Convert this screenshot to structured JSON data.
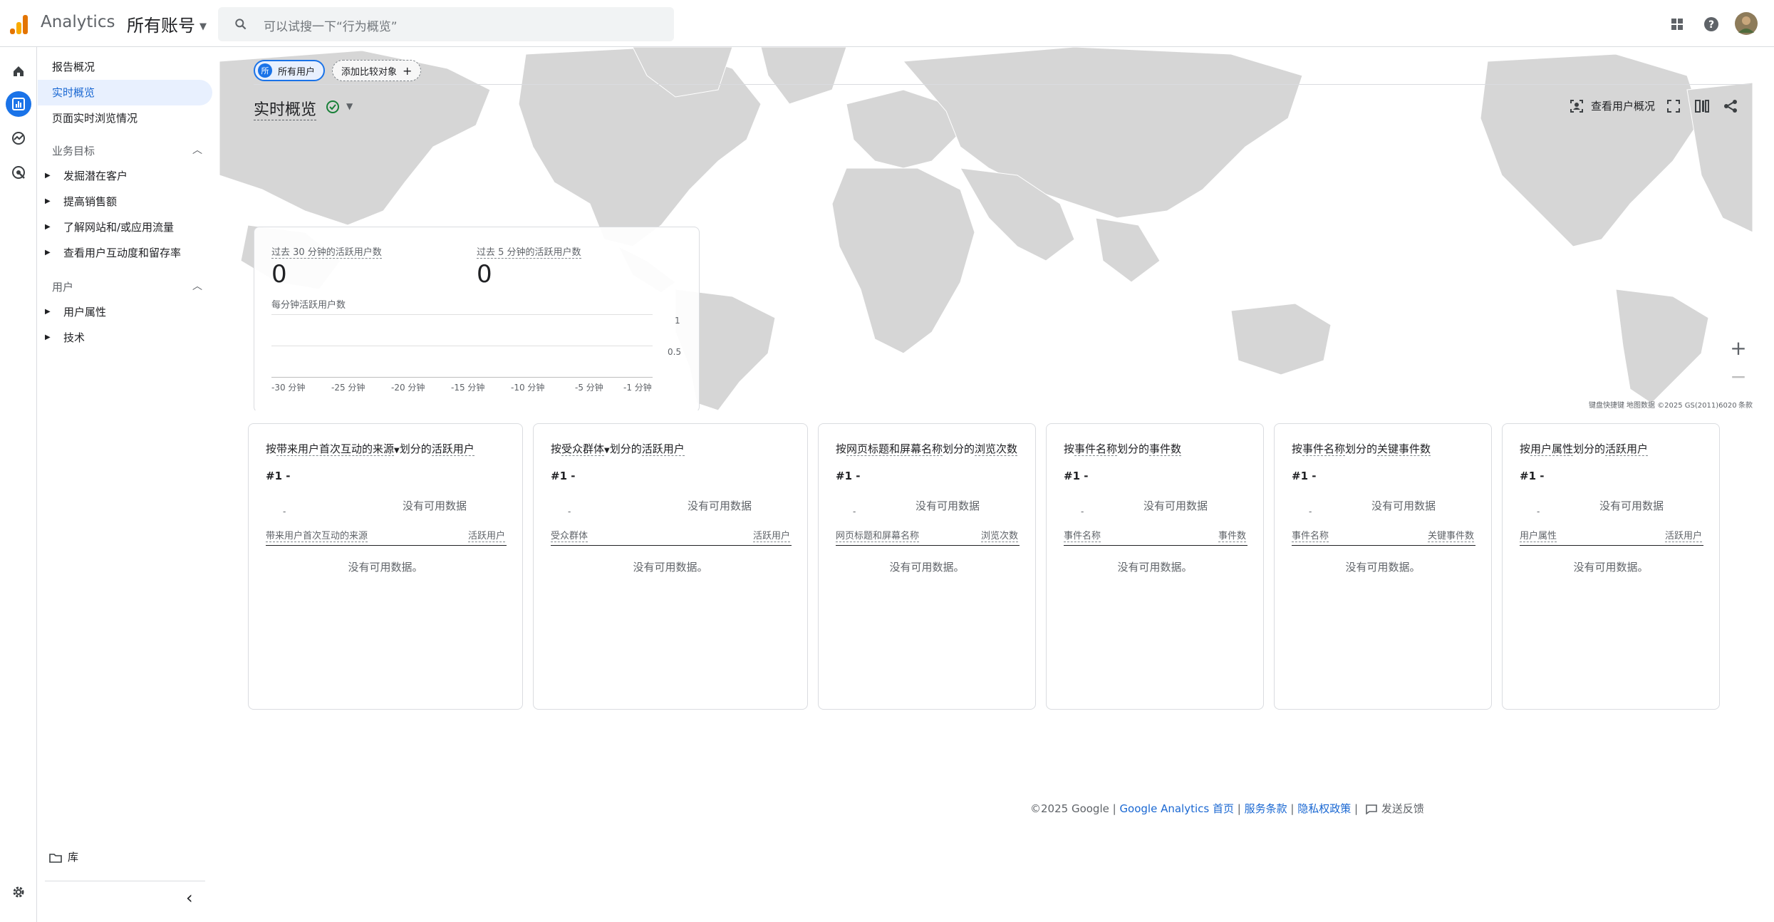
{
  "app": {
    "name": "Analytics",
    "account": "所有账号",
    "search_placeholder": "可以试搜一下“行为概览”"
  },
  "nav": {
    "items": [
      "报告概况",
      "实时概览",
      "页面实时浏览情况"
    ],
    "section1": {
      "title": "业务目标",
      "items": [
        "发掘潜在客户",
        "提高销售额",
        "了解网站和/或应用流量",
        "查看用户互动度和留存率"
      ]
    },
    "section2": {
      "title": "用户",
      "items": [
        "用户属性",
        "技术"
      ]
    },
    "library": "库"
  },
  "toolbar": {
    "chip_all_users": "所有用户",
    "chip_avatar": "所",
    "chip_add_compare": "添加比较对象",
    "page_title": "实时概览",
    "view_user_overview": "查看用户概况"
  },
  "realtime": {
    "label_30": "过去 30 分钟的活跃用户数",
    "value_30": "0",
    "label_5": "过去 5 分钟的活跃用户数",
    "value_5": "0",
    "per_minute": "每分钟活跃用户数",
    "y_ticks": [
      "1",
      "0.5"
    ],
    "x_ticks": [
      "-30 分钟",
      "-25 分钟",
      "-20 分钟",
      "-15 分钟",
      "-10 分钟",
      "-5 分钟",
      "-1 分钟"
    ]
  },
  "map_credit": {
    "shortcuts": "键盘快捷键",
    "data": "地图数据 ©2025 GS(2011)6020",
    "terms": "条款"
  },
  "cards": [
    {
      "title_pre": "按",
      "title_u": "带来用户首次互动的来源",
      "title_post": "划分的",
      "title_u2": "活跃用户",
      "rank": "#1  -",
      "no_data": "没有可用数据",
      "col1": "带来用户首次互动的来源",
      "col2": "活跃用户",
      "empty": "没有可用数据。"
    },
    {
      "title_pre": "按",
      "title_u": "受众群体",
      "title_post": "划分的",
      "title_u2": "活跃用户",
      "rank": "#1  -",
      "no_data": "没有可用数据",
      "col1": "受众群体",
      "col2": "活跃用户",
      "empty": "没有可用数据。"
    },
    {
      "title_pre": "按",
      "title_u": "网页标题和屏幕名称",
      "title_post": "划分的",
      "title_u2": "浏览次数",
      "rank": "#1  -",
      "no_data": "没有可用数据",
      "col1": "网页标题和屏幕名称",
      "col2": "浏览次数",
      "empty": "没有可用数据。"
    },
    {
      "title_pre": "按",
      "title_u": "事件名称",
      "title_post": "划分的",
      "title_u2": "事件数",
      "rank": "#1  -",
      "no_data": "没有可用数据",
      "col1": "事件名称",
      "col2": "事件数",
      "empty": "没有可用数据。"
    },
    {
      "title_pre": "按",
      "title_u": "事件名称",
      "title_post": "划分的",
      "title_u2": "关键事件数",
      "rank": "#1  -",
      "no_data": "没有可用数据",
      "col1": "事件名称",
      "col2": "关键事件数",
      "empty": "没有可用数据。"
    },
    {
      "title_pre": "按",
      "title_u": "用户属性",
      "title_post": "划分的",
      "title_u2": "活跃用户",
      "rank": "#1  -",
      "no_data": "没有可用数据",
      "col1": "用户属性",
      "col2": "活跃用户",
      "empty": "没有可用数据。"
    }
  ],
  "footer": {
    "copyright": "©2025 Google | ",
    "ga_home": "Google Analytics 首页",
    "sep1": " | ",
    "terms": "服务条款",
    "sep2": " | ",
    "privacy": "隐私权政策",
    "sep3": " | ",
    "feedback": "发送反馈"
  },
  "colors": {
    "accent": "#1a73e8",
    "selected_bg": "#e8f0fe",
    "border": "#dadce0",
    "map_land": "#d9d9d9"
  },
  "icons": [
    "search-icon",
    "apps-icon",
    "help-icon",
    "home-icon",
    "reports-icon",
    "explore-icon",
    "advertising-icon",
    "settings-icon",
    "folder-icon",
    "check-circle-icon",
    "share-icon"
  ]
}
